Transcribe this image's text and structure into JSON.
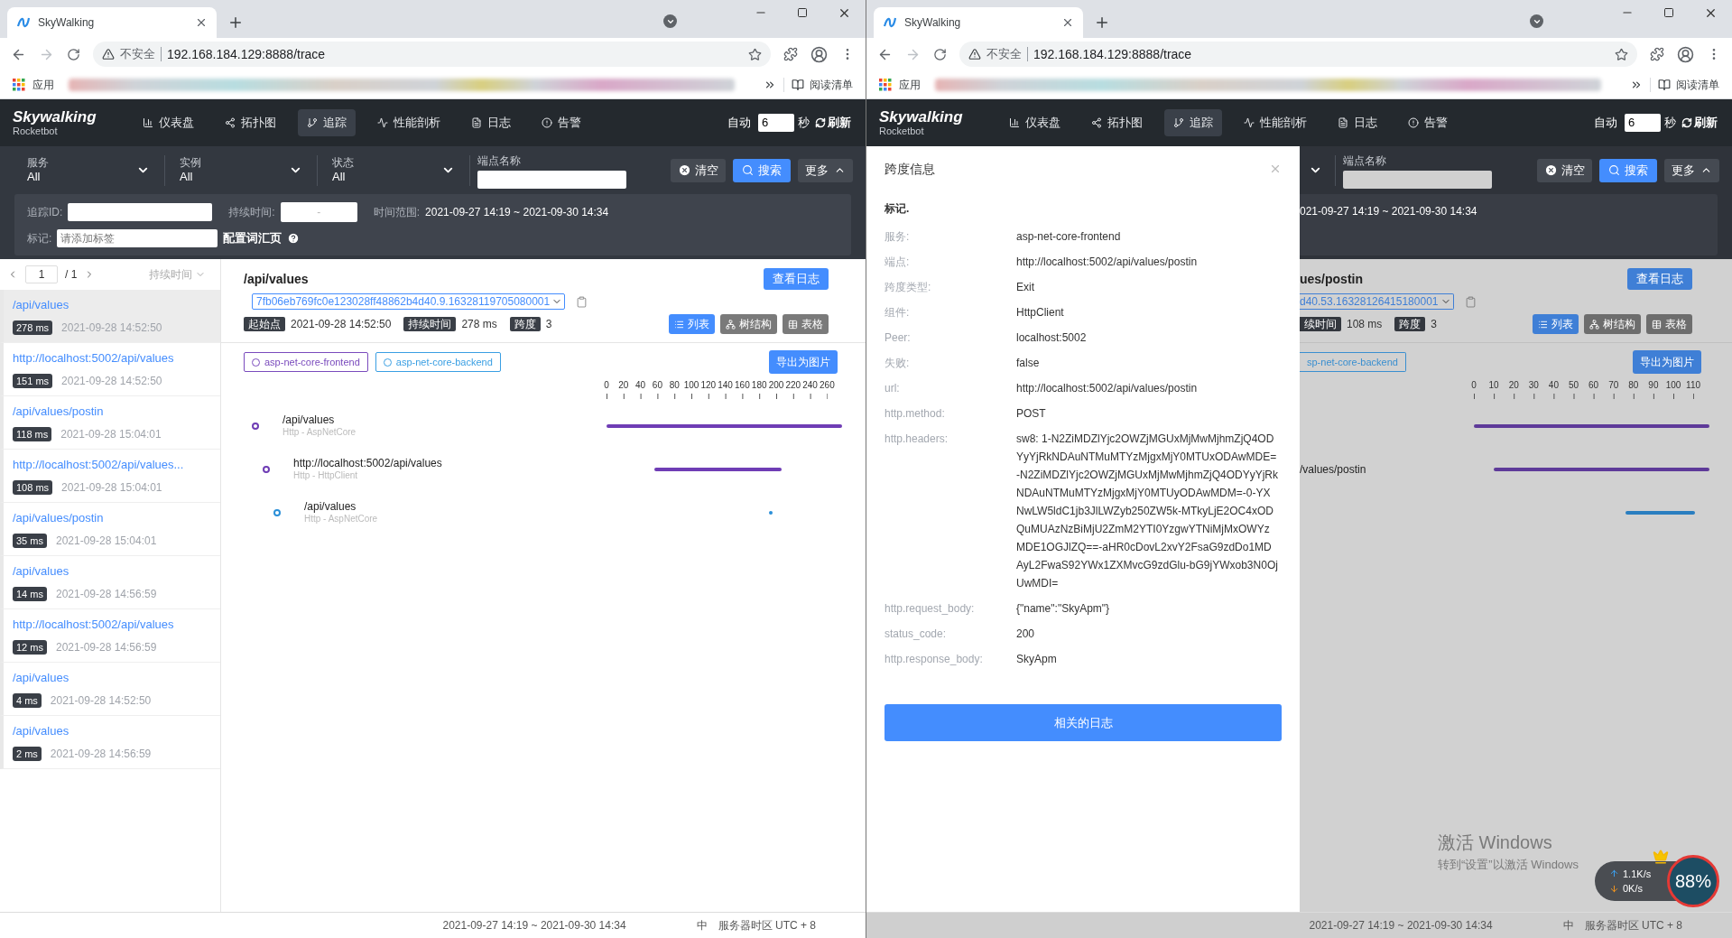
{
  "left_browser": {
    "chrome": {
      "tab_title": "SkyWalking",
      "security": "不安全",
      "url": "192.168.184.129:8888/trace",
      "apps_label": "应用",
      "reading_list": "阅读清单"
    },
    "nav": {
      "logo": "Skywalking",
      "logo_sub": "Rocketbot",
      "items": [
        {
          "label": "仪表盘",
          "selected": false
        },
        {
          "label": "拓扑图",
          "selected": false
        },
        {
          "label": "追踪",
          "selected": true
        },
        {
          "label": "性能剖析",
          "selected": false
        },
        {
          "label": "日志",
          "selected": false
        },
        {
          "label": "告警",
          "selected": false
        }
      ],
      "auto_label": "自动",
      "interval": "6",
      "unit": "秒",
      "refresh": "刷新"
    },
    "filters": {
      "selects": [
        {
          "label": "服务",
          "value": "All"
        },
        {
          "label": "实例",
          "value": "All"
        },
        {
          "label": "状态",
          "value": "All"
        }
      ],
      "endpoint_label": "端点名称",
      "clear": "清空",
      "search": "搜索",
      "more": "更多"
    },
    "more_panel": {
      "trace_id_label": "追踪ID:",
      "duration_label": "持续时间:",
      "duration_separator": "-",
      "time_range_label": "时间范围:",
      "time_range": "2021-09-27 14:19 ~ 2021-09-30 14:34",
      "tag_label": "标记:",
      "tag_placeholder": "请添加标签",
      "vocab_link": "配置词汇页"
    },
    "sidebar": {
      "page": "1",
      "page_total": "/ 1",
      "sort": "持续时间",
      "items": [
        {
          "title": "/api/values",
          "duration": "278 ms",
          "time": "2021-09-28 14:52:50",
          "selected": true
        },
        {
          "title": "http://localhost:5002/api/values",
          "duration": "151 ms",
          "time": "2021-09-28 14:52:50",
          "selected": false
        },
        {
          "title": "/api/values/postin",
          "duration": "118 ms",
          "time": "2021-09-28 15:04:01",
          "selected": false
        },
        {
          "title": "http://localhost:5002/api/values...",
          "duration": "108 ms",
          "time": "2021-09-28 15:04:01",
          "selected": false
        },
        {
          "title": "/api/values/postin",
          "duration": "35 ms",
          "time": "2021-09-28 15:04:01",
          "selected": false
        },
        {
          "title": "/api/values",
          "duration": "14 ms",
          "time": "2021-09-28 14:56:59",
          "selected": false
        },
        {
          "title": "http://localhost:5002/api/values",
          "duration": "12 ms",
          "time": "2021-09-28 14:56:59",
          "selected": false
        },
        {
          "title": "/api/values",
          "duration": "4 ms",
          "time": "2021-09-28 14:52:50",
          "selected": false
        },
        {
          "title": "/api/values",
          "duration": "2 ms",
          "time": "2021-09-28 14:56:59",
          "selected": false
        }
      ]
    },
    "detail": {
      "title": "/api/values",
      "view_logs": "查看日志",
      "trace_id": "7fb06eb769fc0e123028ff48862b4d40.9.16328119705080001",
      "start_label": "起始点",
      "start": "2021-09-28 14:52:50",
      "duration_label": "持续时间",
      "duration": "278 ms",
      "spans_label": "跨度",
      "spans_count": "3",
      "views": [
        {
          "label": "列表",
          "selected": true
        },
        {
          "label": "树结构",
          "selected": false
        },
        {
          "label": "表格",
          "selected": false
        }
      ],
      "services": [
        {
          "name": "asp-net-core-frontend",
          "color": "#7a4bbd"
        },
        {
          "name": "asp-net-core-backend",
          "color": "#3a9fe3"
        }
      ],
      "export": "导出为图片",
      "ticks": [
        "0",
        "20",
        "40",
        "60",
        "80",
        "100",
        "120",
        "140",
        "160",
        "180",
        "200",
        "220",
        "240",
        "260"
      ],
      "spans": [
        {
          "name": "/api/values",
          "component": "Http - AspNetCore",
          "color": "#6f3db5",
          "children": [
            {
              "name": "http://localhost:5002/api/values",
              "component": "Http - HttpClient",
              "color": "#6f3db5",
              "children": [
                {
                  "name": "/api/values",
                  "component": "Http - AspNetCore",
                  "color": "#2a8fd8"
                }
              ]
            }
          ]
        }
      ]
    },
    "footer": {
      "time_range": "2021-09-27 14:19 ~ 2021-09-30 14:34",
      "lang": "中",
      "timezone": "服务器时区 UTC + 8"
    }
  },
  "right_browser": {
    "chrome": {
      "tab_title": "SkyWalking",
      "security": "不安全",
      "url": "192.168.184.129:8888/trace",
      "apps_label": "应用",
      "reading_list": "阅读清单"
    },
    "nav": {
      "logo": "Skywalking",
      "logo_sub": "Rocketbot",
      "items": [
        {
          "label": "仪表盘",
          "selected": false
        },
        {
          "label": "拓扑图",
          "selected": false
        },
        {
          "label": "追踪",
          "selected": true
        },
        {
          "label": "性能剖析",
          "selected": false
        },
        {
          "label": "日志",
          "selected": false
        },
        {
          "label": "告警",
          "selected": false
        }
      ],
      "auto_label": "自动",
      "interval": "6",
      "unit": "秒",
      "refresh": "刷新"
    },
    "drawer": {
      "title": "跨度信息",
      "section": "标记.",
      "rows": [
        {
          "key": "服务:",
          "value": "asp-net-core-frontend"
        },
        {
          "key": "端点:",
          "value": "http://localhost:5002/api/values/postin"
        },
        {
          "key": "跨度类型:",
          "value": "Exit"
        },
        {
          "key": "组件:",
          "value": "HttpClient"
        },
        {
          "key": "Peer:",
          "value": "localhost:5002"
        },
        {
          "key": "失败:",
          "value": "false"
        },
        {
          "key": "url:",
          "value": "http://localhost:5002/api/values/postin"
        },
        {
          "key": "http.method:",
          "value": "POST"
        },
        {
          "key": "http.headers:",
          "value": "sw8: 1-N2ZiMDZlYjc2OWZjMGUxMjMwMjhmZjQ4ODYyYjRkNDAuNTMuMTYzMjgxMjY0MTUxODAwMDE=-N2ZiMDZlYjc2OWZjMGUxMjMwMjhmZjQ4ODYyYjRkNDAuNTMuMTYzMjgxMjY0MTUyODAwMDM=-0-YXNwLW5ldC1jb3JlLWZyb250ZW5k-MTkyLjE2OC4xODQuMUAzNzBiMjU2ZmM2YTI0YzgwYTNiMjMxOWYzMDE1OGJlZQ==-aHR0cDovL2xvY2FsaG9zdDo1MDAyL2FwaS92YWx1ZXMvcG9zdGlu-bG9jYWxob3N0OjUwMDI="
        },
        {
          "key": "http.request_body:",
          "value": "{\"name\":\"SkyApm\"}"
        },
        {
          "key": "status_code:",
          "value": "200"
        },
        {
          "key": "http.response_body:",
          "value": "SkyApm"
        }
      ],
      "logs_button": "相关的日志"
    },
    "filters": {
      "endpoint_label": "端点名称",
      "clear": "清空",
      "search": "搜索",
      "more": "更多"
    },
    "more_panel": {
      "time_range": "021-09-27 14:19 ~ 2021-09-30 14:34"
    },
    "detail": {
      "title": "ues/postin",
      "view_logs": "查看日志",
      "trace_id": "d40.53.16328126415180001",
      "duration_label": "续时间",
      "duration": "108 ms",
      "spans_label": "跨度",
      "spans_count": "3",
      "views": [
        {
          "label": "列表",
          "selected": true
        },
        {
          "label": "树结构",
          "selected": false
        },
        {
          "label": "表格",
          "selected": false
        }
      ],
      "services": [
        {
          "name": "sp-net-core-backend",
          "color": "#3a8fd0"
        }
      ],
      "export": "导出为图片",
      "ticks": [
        "0",
        "10",
        "20",
        "30",
        "40",
        "50",
        "60",
        "70",
        "80",
        "90",
        "100",
        "110"
      ],
      "spans": [
        {
          "color": "#5e3a99",
          "children": [
            {
              "name": "/values/postin",
              "color": "#5e3a99",
              "children": [
                {
                  "color": "#2a7ec0"
                }
              ]
            }
          ]
        }
      ]
    },
    "footer": {
      "time_range": "2021-09-27 14:19 ~ 2021-09-30 14:34",
      "lang": "中",
      "timezone": "服务器时区 UTC + 8"
    }
  },
  "desktop": {
    "activation_title": "激活 Windows",
    "activation_hint": "转到“设置”以激活 Windows",
    "upload": "1.1K/s",
    "download": "0K/s",
    "usage": "88%"
  }
}
